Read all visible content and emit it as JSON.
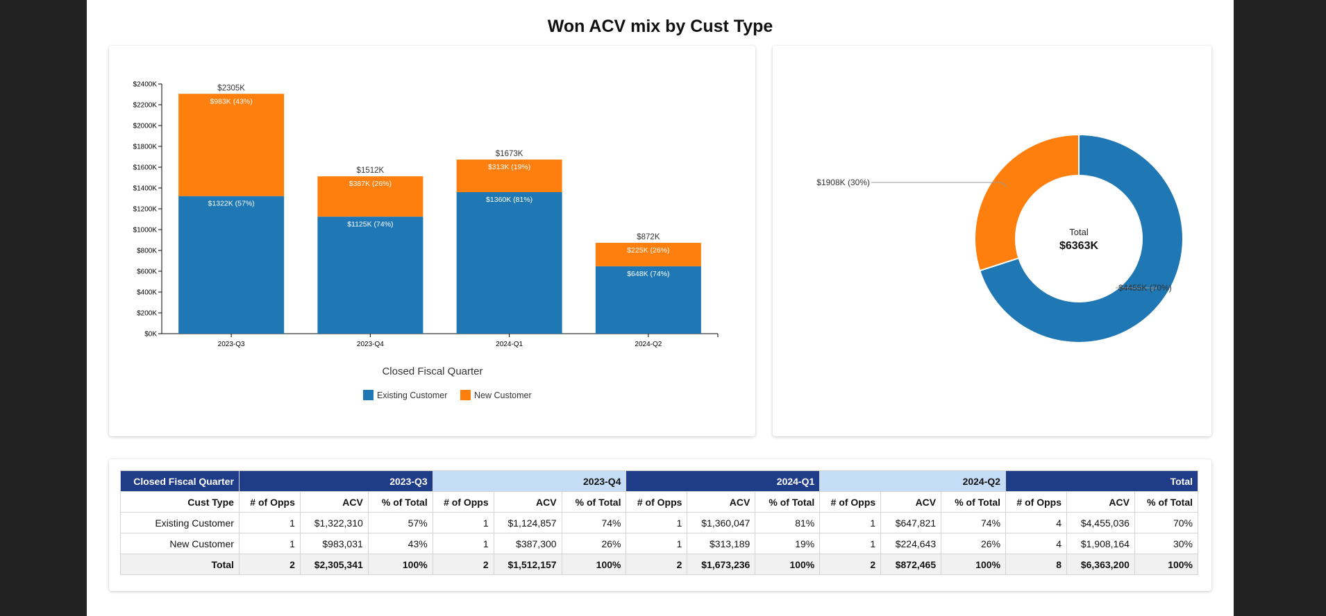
{
  "title": "Won ACV mix by Cust Type",
  "colors": {
    "existing": "#1f77b4",
    "new": "#ff7f0e",
    "hdr_dark": "#1f3c88",
    "hdr_light": "#c5dcf7"
  },
  "chart_data": [
    {
      "type": "bar",
      "stacked": true,
      "categories": [
        "2023-Q3",
        "2023-Q4",
        "2024-Q1",
        "2024-Q2"
      ],
      "series": [
        {
          "name": "Existing Customer",
          "values": [
            1322,
            1125,
            1360,
            648
          ],
          "labels": [
            "$1322K (57%)",
            "$1125K (74%)",
            "$1360K (81%)",
            "$648K (74%)"
          ]
        },
        {
          "name": "New Customer",
          "values": [
            983,
            387,
            313,
            225
          ],
          "labels": [
            "$983K (43%)",
            "$387K (26%)",
            "$313K (19%)",
            "$225K (26%)"
          ]
        }
      ],
      "totals": [
        "$2305K",
        "$1512K",
        "$1673K",
        "$872K"
      ],
      "xlabel": "Closed Fiscal Quarter",
      "ylabel": "",
      "ylim": [
        0,
        2400
      ],
      "yticks": [
        0,
        200,
        400,
        600,
        800,
        1000,
        1200,
        1400,
        1600,
        1800,
        2000,
        2200,
        2400
      ],
      "ytick_labels": [
        "$0K",
        "$200K",
        "$400K",
        "$600K",
        "$800K",
        "$1000K",
        "$1200K",
        "$1400K",
        "$1600K",
        "$1800K",
        "$2000K",
        "$2200K",
        "$2400K"
      ],
      "legend": "bottom",
      "grid": false
    },
    {
      "type": "pie",
      "donut": true,
      "categories": [
        "Existing Customer",
        "New Customer"
      ],
      "values": [
        4455,
        1908
      ],
      "labels": [
        "$4455K (70%)",
        "$1908K (30%)"
      ],
      "center_label": "Total",
      "center_value": "$6363K"
    }
  ],
  "table": {
    "corner": "Closed Fiscal Quarter",
    "row_header": "Cust Type",
    "groups": [
      "2023-Q3",
      "2023-Q4",
      "2024-Q1",
      "2024-Q2",
      "Total"
    ],
    "subcols": [
      "# of Opps",
      "ACV",
      "% of Total"
    ],
    "rows": [
      {
        "label": "Existing Customer",
        "cells": [
          "1",
          "$1,322,310",
          "57%",
          "1",
          "$1,124,857",
          "74%",
          "1",
          "$1,360,047",
          "81%",
          "1",
          "$647,821",
          "74%",
          "4",
          "$4,455,036",
          "70%"
        ]
      },
      {
        "label": "New Customer",
        "cells": [
          "1",
          "$983,031",
          "43%",
          "1",
          "$387,300",
          "26%",
          "1",
          "$313,189",
          "19%",
          "1",
          "$224,643",
          "26%",
          "4",
          "$1,908,164",
          "30%"
        ]
      }
    ],
    "total": {
      "label": "Total",
      "cells": [
        "2",
        "$2,305,341",
        "100%",
        "2",
        "$1,512,157",
        "100%",
        "2",
        "$1,673,236",
        "100%",
        "2",
        "$872,465",
        "100%",
        "8",
        "$6,363,200",
        "100%"
      ]
    }
  }
}
